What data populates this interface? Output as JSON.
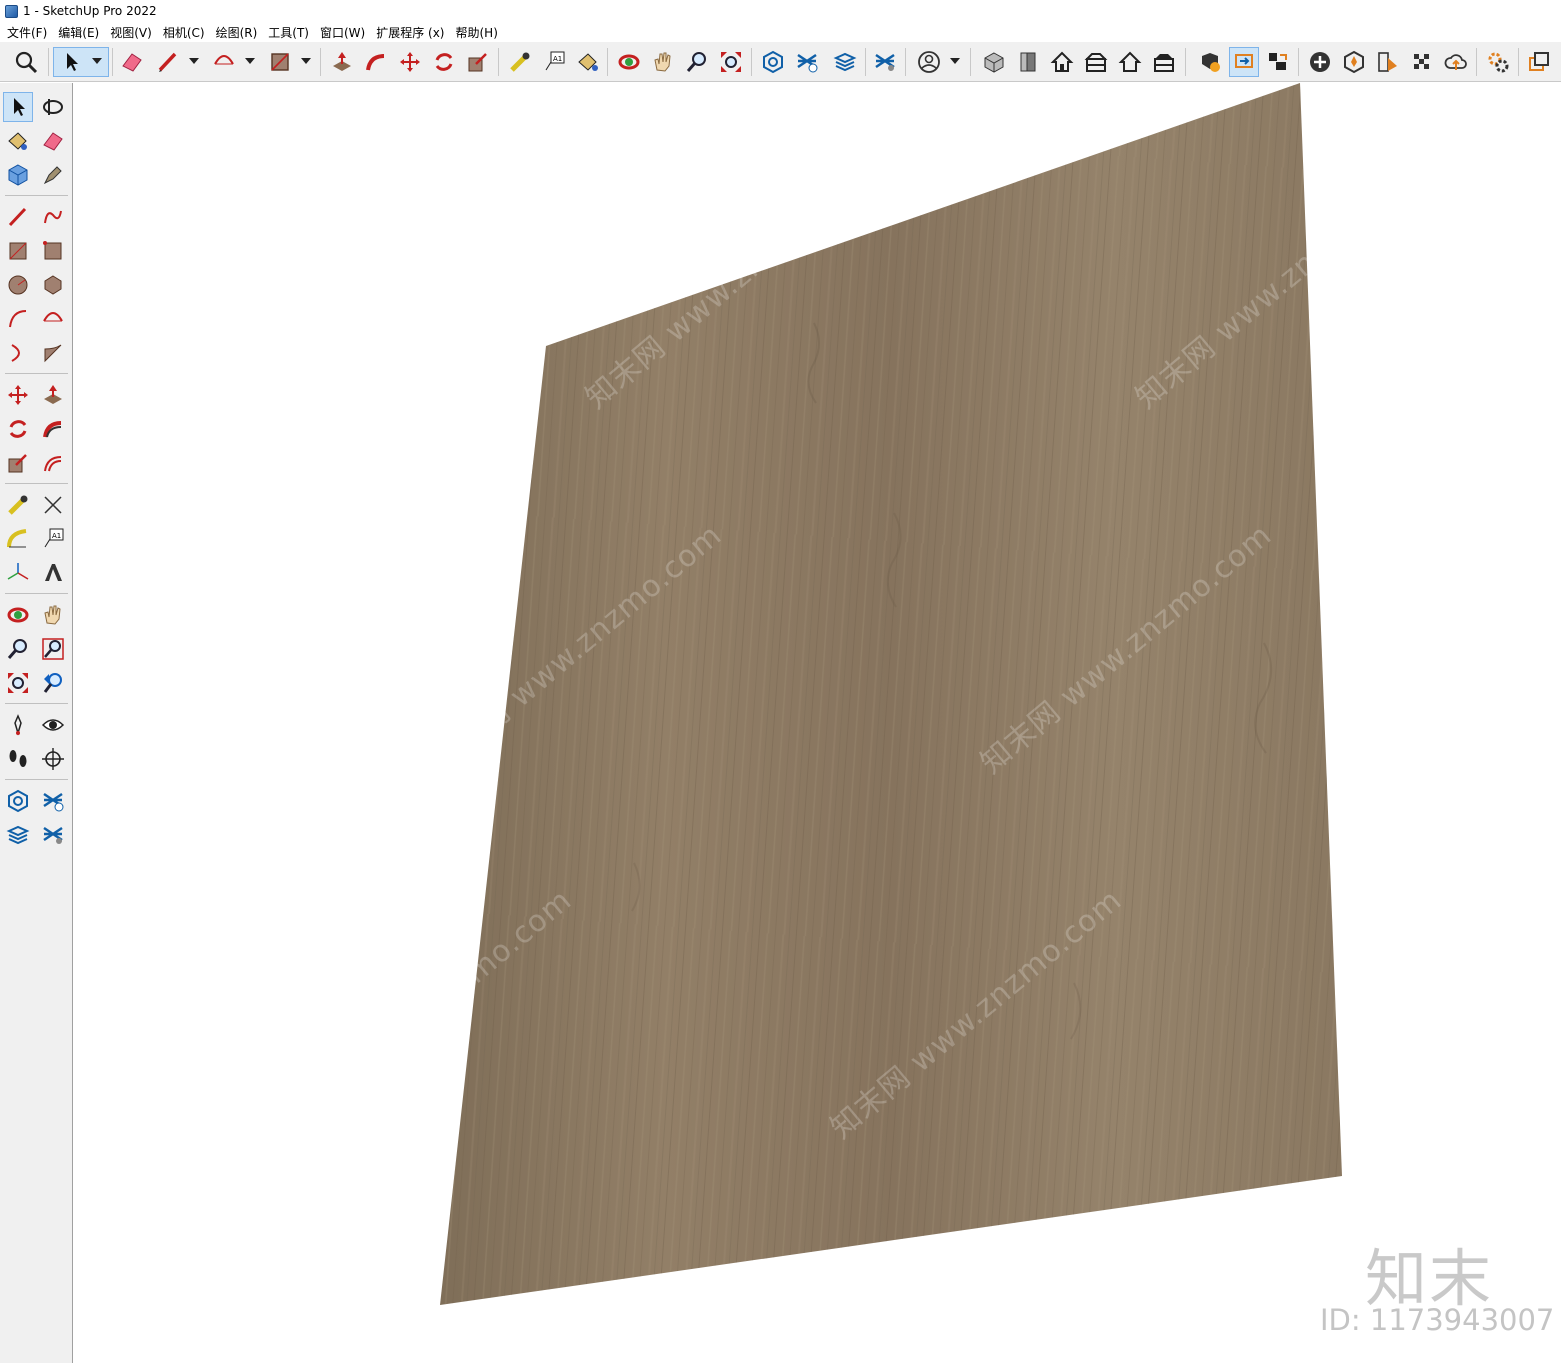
{
  "window": {
    "title": "1 - SketchUp Pro 2022"
  },
  "menu": {
    "items": [
      "文件(F)",
      "编辑(E)",
      "视图(V)",
      "相机(C)",
      "绘图(R)",
      "工具(T)",
      "窗口(W)",
      "扩展程序 (x)",
      "帮助(H)"
    ]
  },
  "toolbar": {
    "icons": [
      "zoom-extents-icon",
      "select-icon",
      "select-dropdown-icon",
      "eraser-icon",
      "pencil-icon",
      "pencil-dropdown-icon",
      "arc-icon",
      "arc-dropdown-icon",
      "rectangle-icon",
      "rectangle-dropdown-icon",
      "push-pull-icon",
      "follow-me-icon",
      "move-icon",
      "rotate-icon",
      "scale-icon",
      "tape-measure-icon",
      "text-icon",
      "paint-bucket-icon",
      "orbit-icon",
      "pan-icon",
      "zoom-icon",
      "zoom-extents-arrows-icon",
      "warehouse-icon",
      "extension-warehouse-icon",
      "layout-icon",
      "extension-manager-icon",
      "account-icon",
      "iso-view-icon",
      "front-view-icon",
      "top-view-icon",
      "back-view-icon",
      "left-view-icon",
      "right-view-icon",
      "check-icon",
      "section-icon",
      "camera-icon",
      "add-location-icon",
      "sandbox-icon",
      "styles-icon",
      "texture-icon",
      "cloud-icon",
      "settings-icon",
      "dialog-icon"
    ],
    "active": "select-icon"
  },
  "left_toolbar": {
    "icons": [
      "select-icon",
      "orbit-icon",
      "paint-icon",
      "eraser-icon",
      "component-icon",
      "tag-icon",
      "pencil-icon",
      "freehand-icon",
      "rectangle-icon",
      "rotated-rectangle-icon",
      "circle-icon",
      "polygon-icon",
      "arc-icon",
      "two-point-arc-icon",
      "three-point-arc-icon",
      "pie-icon",
      "move-icon",
      "push-pull-icon",
      "rotate-icon",
      "follow-me-icon",
      "scale-icon",
      "offset-icon",
      "tape-measure-icon",
      "dimension-icon",
      "protractor-icon",
      "text-icon",
      "axes-icon",
      "3d-text-icon",
      "orbit-view-icon",
      "pan-icon",
      "zoom-icon",
      "zoom-window-icon",
      "zoom-extents-icon",
      "previous-view-icon",
      "position-camera-icon",
      "look-around-icon",
      "walk-icon",
      "section-plane-icon",
      "warehouse-icon",
      "extension-warehouse-icon",
      "layout-send-icon",
      "extension-manager-icon"
    ],
    "active": "select-icon"
  },
  "viewport": {
    "panel_material": "wood-veneer",
    "watermark_text": "知末网 www.znzmo.com",
    "brand_logo": "知末",
    "brand_id": "ID: 1173943007"
  },
  "colors": {
    "wood_base": "#8c7a63",
    "wood_light": "#9a8870",
    "wood_dark": "#7a6a55"
  }
}
